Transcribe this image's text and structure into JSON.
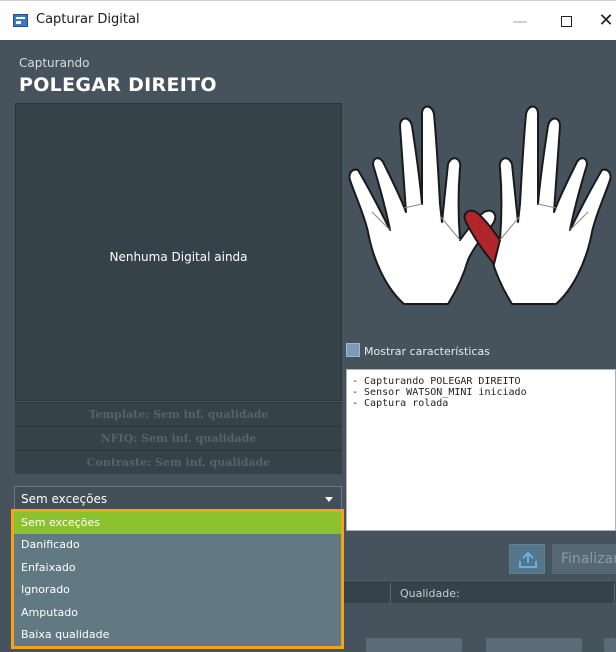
{
  "window": {
    "title": "Capturar Digital",
    "minimize_glyph": "—",
    "close_glyph": "✕"
  },
  "header": {
    "subtitle": "Capturando",
    "finger": "POLEGAR DIREITO"
  },
  "preview": {
    "empty_text": "Nenhuma Digital ainda"
  },
  "quality": {
    "template": "Template: Sem inf. qualidade",
    "nfiq": "NFIQ: Sem inf. qualidade",
    "contrast": "Contraste: Sem inf. qualidade"
  },
  "exception": {
    "selected": "Sem exceções",
    "options": [
      "Sem exceções",
      "Danificado",
      "Enfaixado",
      "Ignorado",
      "Amputado",
      "Baixa qualidade"
    ]
  },
  "hands": {
    "highlighted_finger": "right-thumb",
    "highlight_color": "#b0262a"
  },
  "features": {
    "label": "Mostrar características",
    "checked": false
  },
  "log": {
    "lines": [
      "- Capturando POLEGAR DIREITO",
      "- Sensor WATSON_MINI iniciado",
      "- Captura rolada"
    ]
  },
  "actions": {
    "upload_icon": "upload-icon",
    "finish_label": "Finalizar"
  },
  "status": {
    "quality_label": "Qualidade:"
  },
  "colors": {
    "background": "#46535c",
    "dropdown_border": "#f5a21f",
    "selected_option": "#8cc12e"
  }
}
